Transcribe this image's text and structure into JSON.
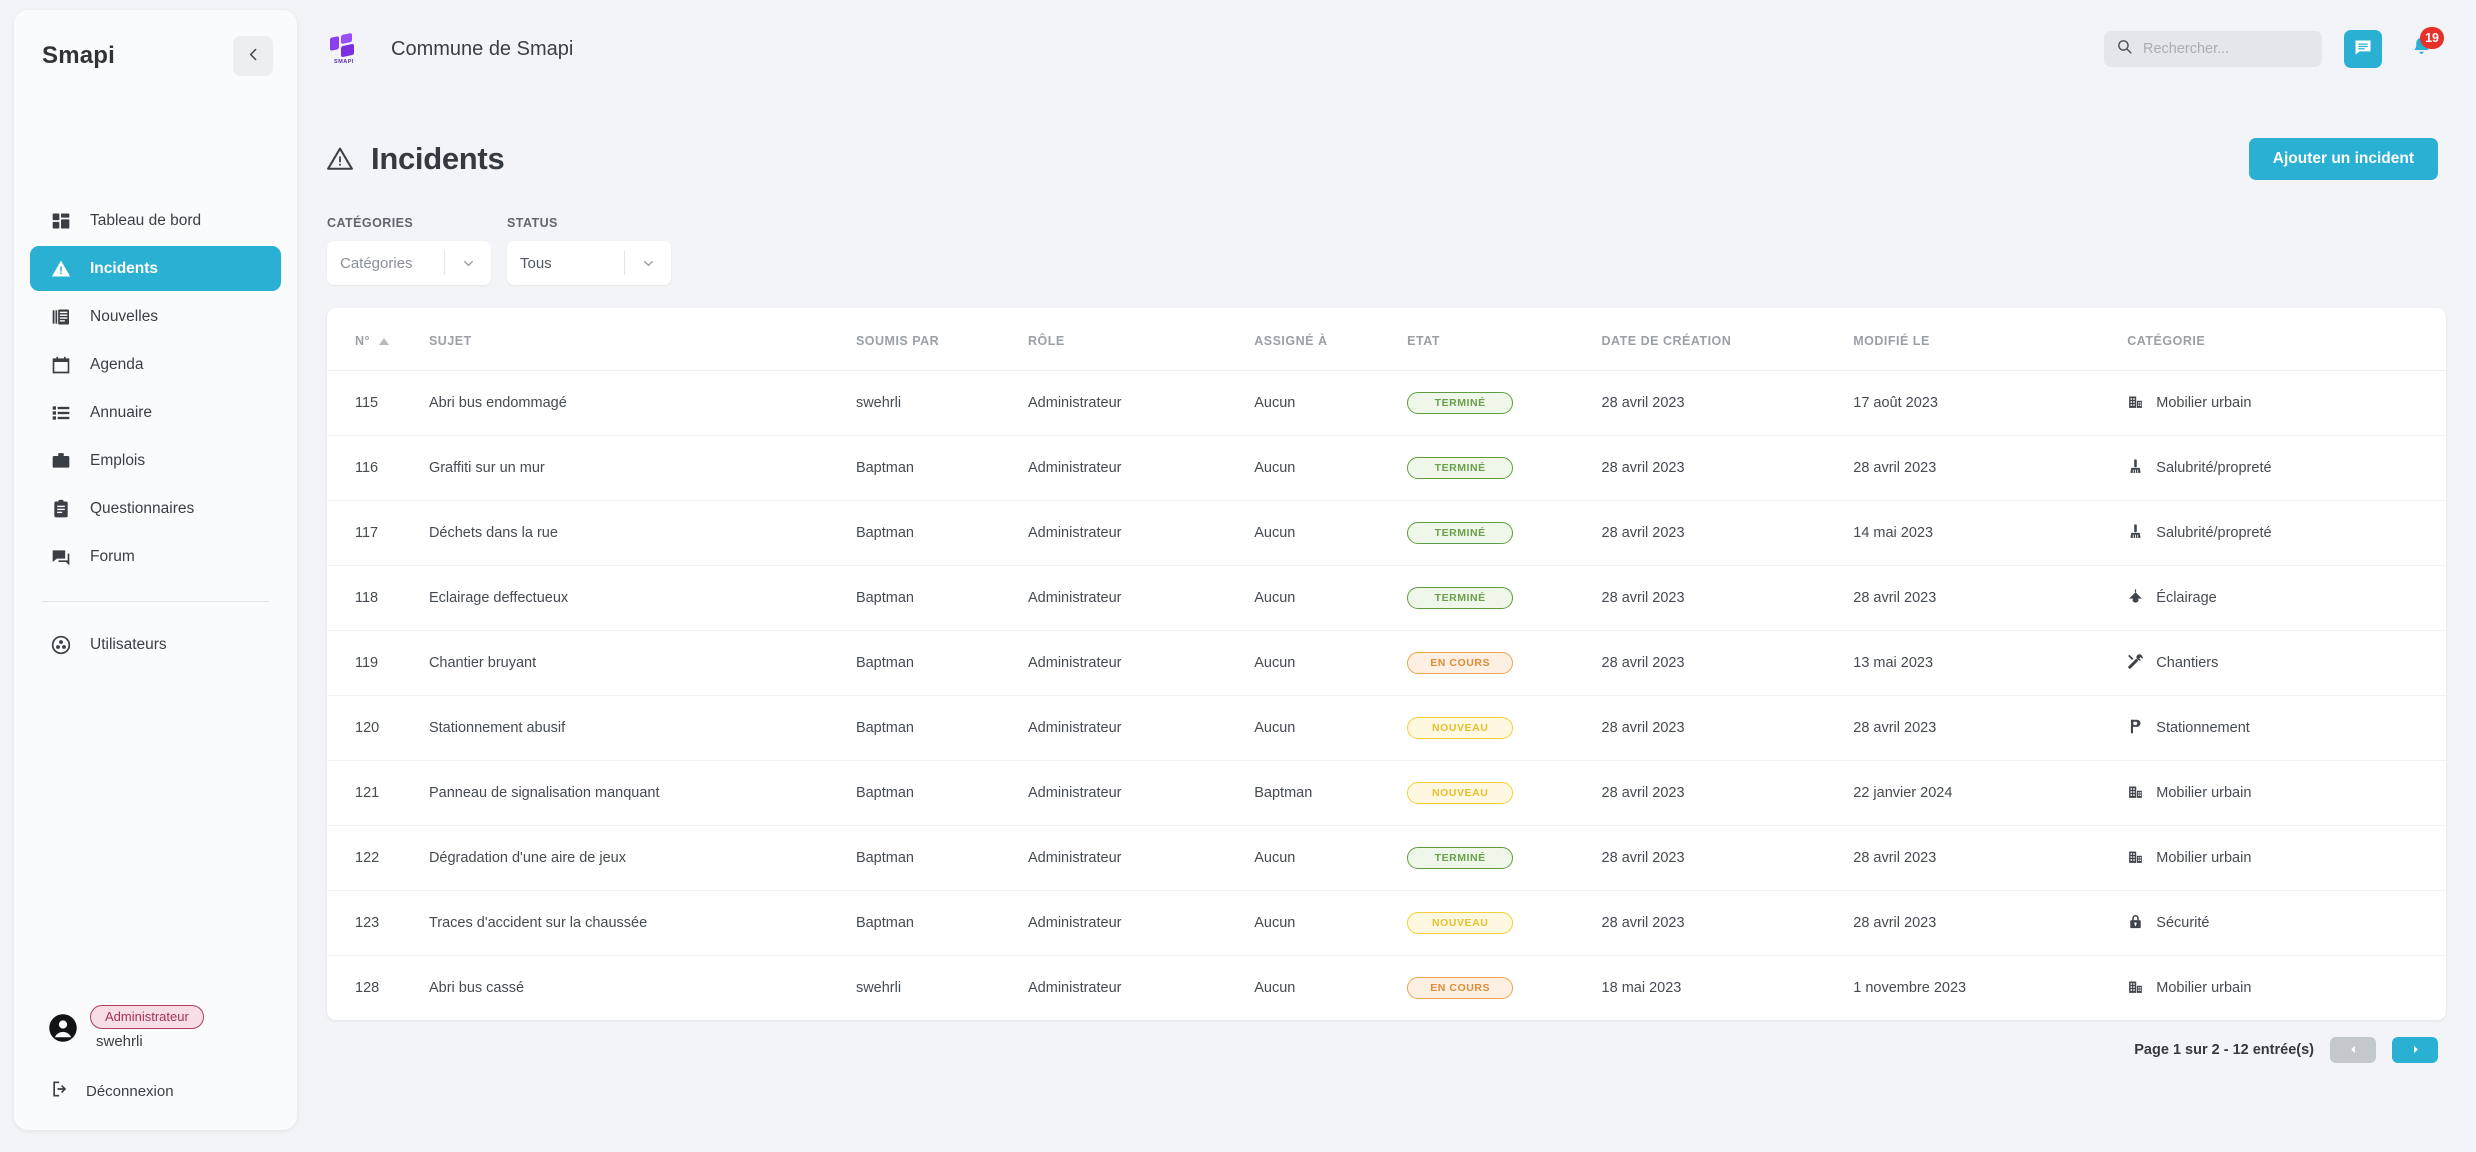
{
  "sidebar": {
    "brand": "Smapi",
    "collapse_icon": "chevron-left-icon",
    "items": [
      {
        "label": "Tableau de bord",
        "icon": "dashboard-icon",
        "active": false
      },
      {
        "label": "Incidents",
        "icon": "warning-triangle-icon",
        "active": true
      },
      {
        "label": "Nouvelles",
        "icon": "news-icon",
        "active": false
      },
      {
        "label": "Agenda",
        "icon": "calendar-icon",
        "active": false
      },
      {
        "label": "Annuaire",
        "icon": "list-icon",
        "active": false
      },
      {
        "label": "Emplois",
        "icon": "briefcase-icon",
        "active": false
      },
      {
        "label": "Questionnaires",
        "icon": "clipboard-icon",
        "active": false
      },
      {
        "label": "Forum",
        "icon": "forum-icon",
        "active": false
      }
    ],
    "secondary_items": [
      {
        "label": "Utilisateurs",
        "icon": "users-icon",
        "active": false
      }
    ],
    "profile": {
      "role": "Administrateur",
      "username": "swehrli",
      "avatar_icon": "account-circle-icon"
    },
    "logout": {
      "label": "Déconnexion",
      "icon": "logout-icon"
    }
  },
  "topbar": {
    "logo_name": "smapi-logo",
    "logo_text": "SMAPI",
    "site_title": "Commune de Smapi",
    "search": {
      "placeholder": "Rechercher...",
      "value": "",
      "icon": "search-icon"
    },
    "chat_icon": "chat-icon",
    "bell_icon": "bell-icon",
    "notification_count": "19"
  },
  "page": {
    "title": "Incidents",
    "title_icon": "warning-triangle-icon",
    "add_button": "Ajouter un incident"
  },
  "filters": {
    "categories": {
      "label": "CATÉGORIES",
      "value": "Catégories",
      "is_placeholder": true
    },
    "status": {
      "label": "STATUS",
      "value": "Tous",
      "is_placeholder": false
    }
  },
  "table": {
    "columns": [
      "N°",
      "SUJET",
      "SOUMIS PAR",
      "RÔLE",
      "ASSIGNÉ À",
      "ETAT",
      "DATE DE CRÉATION",
      "MODIFIÉ LE",
      "CATÉGORIE"
    ],
    "sort_column": "N°",
    "sort_direction": "asc",
    "rows": [
      {
        "num": "115",
        "sujet": "Abri bus endommagé",
        "soumis": "swehrli",
        "role": "Administrateur",
        "assigne": "Aucun",
        "etat": "TERMINÉ",
        "etat_kind": "done",
        "created": "28 avril 2023",
        "modified": "17 août 2023",
        "categorie": "Mobilier urbain",
        "cat_icon": "building-icon"
      },
      {
        "num": "116",
        "sujet": "Graffiti sur un mur",
        "soumis": "Baptman",
        "role": "Administrateur",
        "assigne": "Aucun",
        "etat": "TERMINÉ",
        "etat_kind": "done",
        "created": "28 avril 2023",
        "modified": "28 avril 2023",
        "categorie": "Salubrité/propreté",
        "cat_icon": "broom-icon"
      },
      {
        "num": "117",
        "sujet": "Déchets dans la rue",
        "soumis": "Baptman",
        "role": "Administrateur",
        "assigne": "Aucun",
        "etat": "TERMINÉ",
        "etat_kind": "done",
        "created": "28 avril 2023",
        "modified": "14 mai 2023",
        "categorie": "Salubrité/propreté",
        "cat_icon": "broom-icon"
      },
      {
        "num": "118",
        "sujet": "Eclairage deffectueux",
        "soumis": "Baptman",
        "role": "Administrateur",
        "assigne": "Aucun",
        "etat": "TERMINÉ",
        "etat_kind": "done",
        "created": "28 avril 2023",
        "modified": "28 avril 2023",
        "categorie": "Éclairage",
        "cat_icon": "lamp-icon"
      },
      {
        "num": "119",
        "sujet": "Chantier bruyant",
        "soumis": "Baptman",
        "role": "Administrateur",
        "assigne": "Aucun",
        "etat": "EN COURS",
        "etat_kind": "prog",
        "created": "28 avril 2023",
        "modified": "13 mai 2023",
        "categorie": "Chantiers",
        "cat_icon": "tools-icon"
      },
      {
        "num": "120",
        "sujet": "Stationnement abusif",
        "soumis": "Baptman",
        "role": "Administrateur",
        "assigne": "Aucun",
        "etat": "NOUVEAU",
        "etat_kind": "new",
        "created": "28 avril 2023",
        "modified": "28 avril 2023",
        "categorie": "Stationnement",
        "cat_icon": "parking-icon"
      },
      {
        "num": "121",
        "sujet": "Panneau de signalisation manquant",
        "soumis": "Baptman",
        "role": "Administrateur",
        "assigne": "Baptman",
        "etat": "NOUVEAU",
        "etat_kind": "new",
        "created": "28 avril 2023",
        "modified": "22 janvier 2024",
        "categorie": "Mobilier urbain",
        "cat_icon": "building-icon"
      },
      {
        "num": "122",
        "sujet": "Dégradation d'une aire de jeux",
        "soumis": "Baptman",
        "role": "Administrateur",
        "assigne": "Aucun",
        "etat": "TERMINÉ",
        "etat_kind": "done",
        "created": "28 avril 2023",
        "modified": "28 avril 2023",
        "categorie": "Mobilier urbain",
        "cat_icon": "building-icon"
      },
      {
        "num": "123",
        "sujet": "Traces d'accident sur la chaussée",
        "soumis": "Baptman",
        "role": "Administrateur",
        "assigne": "Aucun",
        "etat": "NOUVEAU",
        "etat_kind": "new",
        "created": "28 avril 2023",
        "modified": "28 avril 2023",
        "categorie": "Sécurité",
        "cat_icon": "lock-icon"
      },
      {
        "num": "128",
        "sujet": "Abri bus cassé",
        "soumis": "swehrli",
        "role": "Administrateur",
        "assigne": "Aucun",
        "etat": "EN COURS",
        "etat_kind": "prog",
        "created": "18 mai 2023",
        "modified": "1 novembre 2023",
        "categorie": "Mobilier urbain",
        "cat_icon": "building-icon"
      }
    ]
  },
  "pagination": {
    "text": "Page 1 sur 2 - 12 entrée(s)",
    "prev_icon": "chevron-left-icon",
    "next_icon": "chevron-right-icon",
    "prev_enabled": false,
    "next_enabled": true
  },
  "colors": {
    "accent": "#29b0d3",
    "badge_red": "#e8302a",
    "status_done": "#6aa04a",
    "status_progress": "#e08c36",
    "status_new": "#e5bf2e",
    "role_pill": "#a33456",
    "logo_purple": "#8b3ff0"
  }
}
